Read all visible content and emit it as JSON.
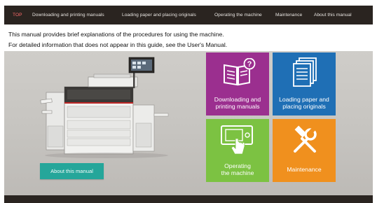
{
  "nav": {
    "items": [
      "TOP",
      "Downloading and printing manuals",
      "Loading paper and placing originals",
      "Operating the machine",
      "Maintenance",
      "About this manual"
    ]
  },
  "intro": {
    "line1": "This manual provides brief explanations of the procedures for using the machine.",
    "line2": "For detailed information that does not appear in this guide, see the User's Manual."
  },
  "about_button": "About this manual",
  "tiles": {
    "downloading": {
      "line1": "Downloading and",
      "line2": "printing manuals",
      "color": "#9b2f8f",
      "icon": "book-question-icon"
    },
    "loading": {
      "line1": "Loading paper and",
      "line2": "placing originals",
      "color": "#1f6fb5",
      "icon": "paper-stack-icon"
    },
    "operating": {
      "line1": "Operating",
      "line2": "the machine",
      "color": "#7cc242",
      "icon": "touch-panel-icon"
    },
    "maintenance": {
      "line1": "Maintenance",
      "color": "#f0901e",
      "icon": "tools-icon"
    }
  },
  "colors": {
    "navbar": "#2a2420",
    "active_nav": "#ff6b6b",
    "about_button": "#25a69a"
  }
}
